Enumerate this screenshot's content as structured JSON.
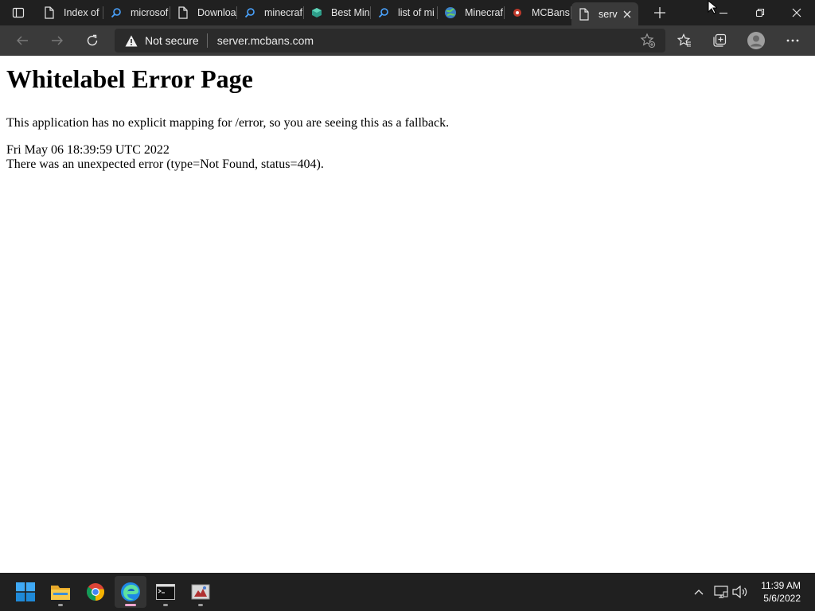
{
  "browser": {
    "tabs": [
      {
        "title": "Index of",
        "favicon": "page-icon"
      },
      {
        "title": "microsof",
        "favicon": "search-icon"
      },
      {
        "title": "Downloa",
        "favicon": "page-icon"
      },
      {
        "title": "minecraf",
        "favicon": "search-icon"
      },
      {
        "title": "Best Min",
        "favicon": "cube-icon"
      },
      {
        "title": "list of mi",
        "favicon": "search-icon"
      },
      {
        "title": "Minecraf",
        "favicon": "globe-icon"
      },
      {
        "title": "MCBans",
        "favicon": "mcbans-icon"
      },
      {
        "title": "serv",
        "favicon": "page-icon",
        "active": true
      }
    ],
    "address": {
      "security_label": "Not secure",
      "url": "server.mcbans.com"
    }
  },
  "page": {
    "heading": "Whitelabel Error Page",
    "message": "This application has no explicit mapping for /error, so you are seeing this as a fallback.",
    "timestamp": "Fri May 06 18:39:59 UTC 2022",
    "error": "There was an unexpected error (type=Not Found, status=404)."
  },
  "taskbar": {
    "time": "11:39 AM",
    "date": "5/6/2022",
    "apps": [
      "windows-start-icon",
      "file-explorer-icon",
      "chrome-icon",
      "edge-icon",
      "terminal-icon",
      "app-icon"
    ]
  },
  "colors": {
    "chrome_dark": "#202020",
    "toolbar": "#3a3a3a",
    "active_indicator": "#f4a6cf"
  }
}
